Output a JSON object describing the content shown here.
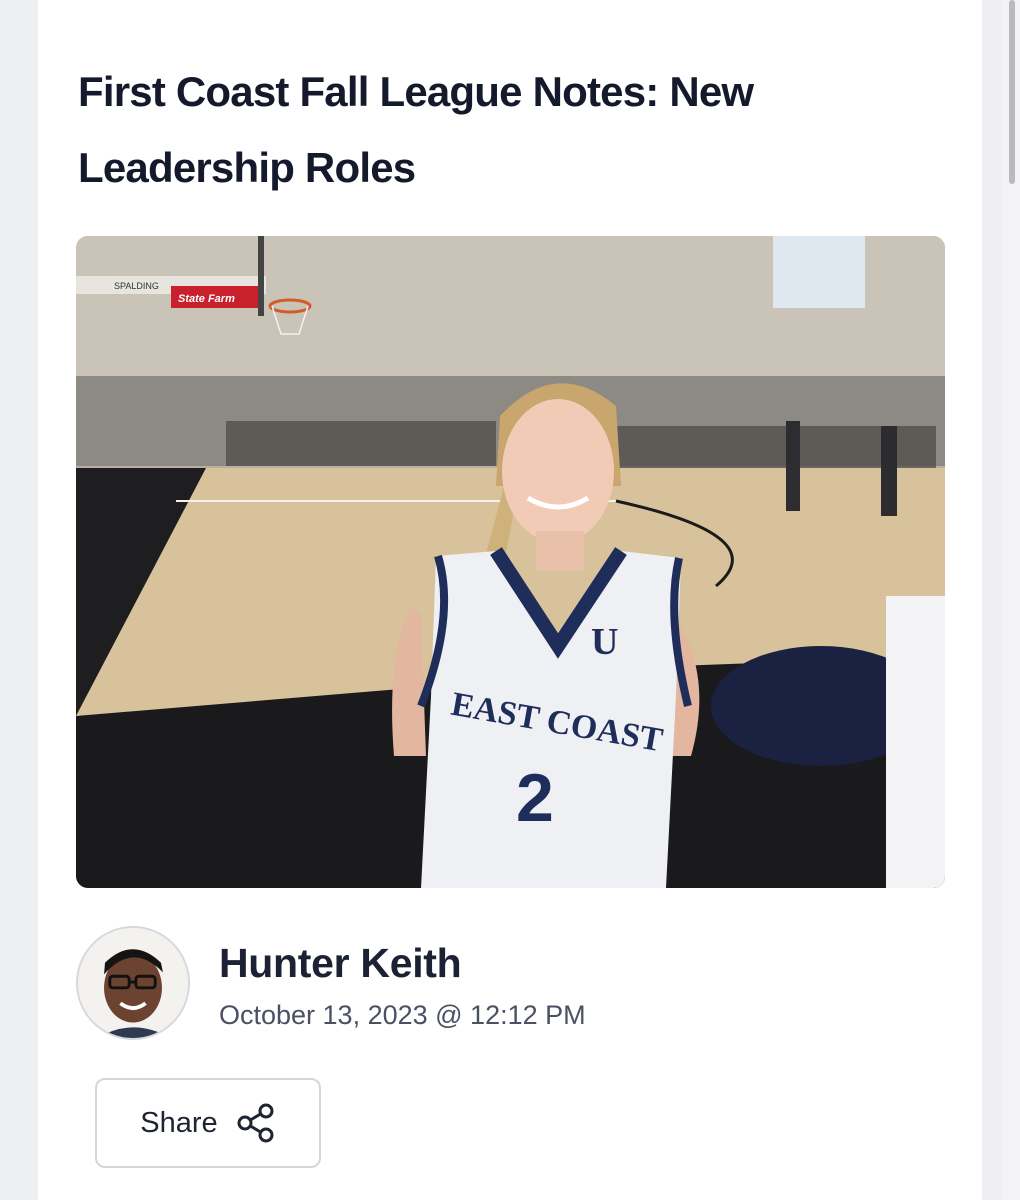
{
  "article": {
    "title": "First Coast Fall League Notes: New Leadership Roles",
    "hero_image": {
      "banner_text": "State Farm",
      "hoop_brand": "SPALDING",
      "jersey_team": "EAST COAST",
      "jersey_number": "2",
      "jersey_logo": "U"
    }
  },
  "author": {
    "name": "Hunter Keith",
    "date": "October 13, 2023 @ 12:12 PM"
  },
  "share": {
    "label": "Share",
    "icon": "share-icon"
  },
  "colors": {
    "page_background": "#eeeff2",
    "card_background": "#ffffff",
    "title_text": "#141a2c",
    "jersey_navy": "#1f2d5a"
  }
}
